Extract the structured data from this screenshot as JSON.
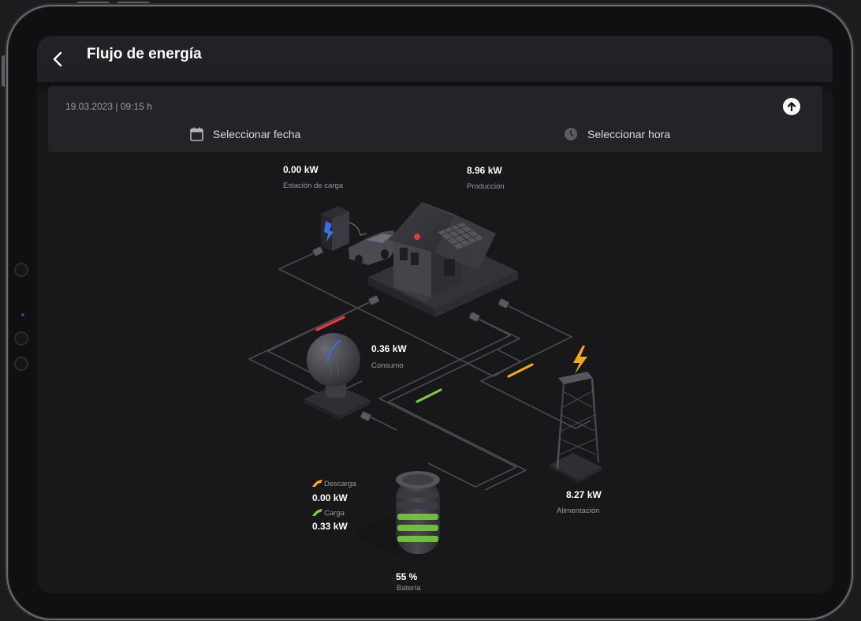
{
  "header": {
    "title": "Flujo de energía"
  },
  "panel": {
    "datetime": "19.03.2023 | 09:15 h",
    "select_date": "Seleccionar fecha",
    "select_time": "Seleccionar hora"
  },
  "charging_station": {
    "value": "0.00 kW",
    "label": "Estación de carga"
  },
  "production": {
    "value": "8.96 kW",
    "label": "Producción"
  },
  "consumption": {
    "value": "0.36 kW",
    "label": "Consumo"
  },
  "grid": {
    "value": "8.27 kW",
    "label": "Alimentación"
  },
  "battery": {
    "discharge_label": "Descarga",
    "discharge_value": "0.00 kW",
    "charge_label": "Carga",
    "charge_value": "0.33 kW",
    "percent": "55 %",
    "label": "Batería"
  },
  "colors": {
    "accent_red": "#e03a3a",
    "accent_green": "#7ac943",
    "accent_orange": "#f5a623",
    "accent_blue": "#3b6ee0"
  }
}
